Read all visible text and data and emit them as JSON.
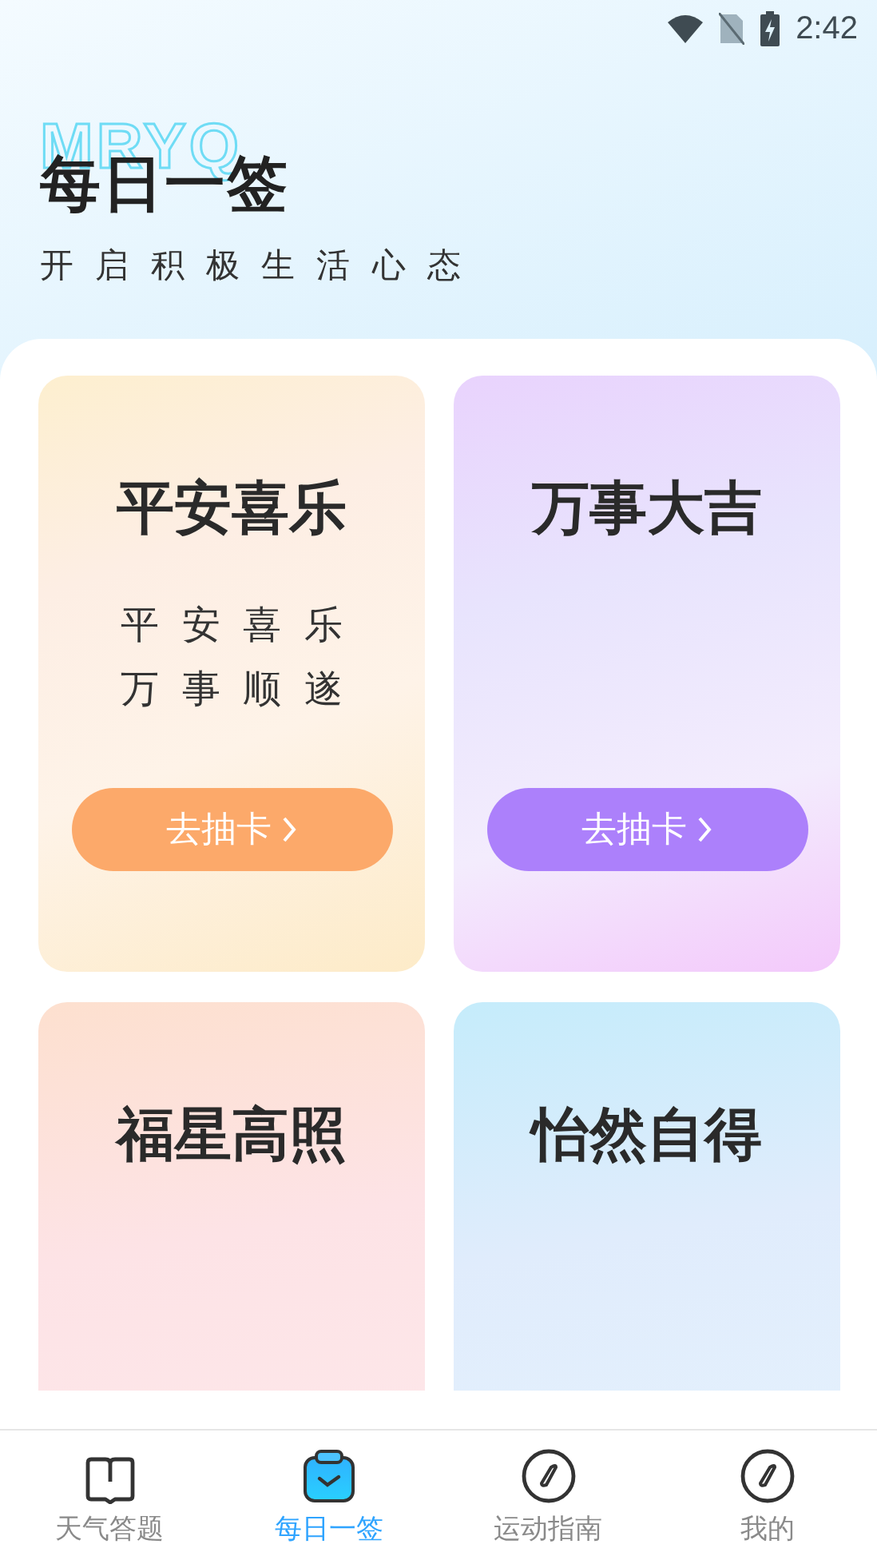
{
  "status_bar": {
    "time": "2:42"
  },
  "header": {
    "watermark": "MRYQ",
    "title": "每日一签",
    "subtitle": "开启积极生活心态"
  },
  "cards": [
    {
      "kind": "orange",
      "title": "平安喜乐",
      "lines": [
        "平安喜乐",
        "万事顺遂"
      ],
      "button": "去抽卡"
    },
    {
      "kind": "purple",
      "title": "万事大吉",
      "button": "去抽卡"
    },
    {
      "kind": "pink",
      "title": "福星高照"
    },
    {
      "kind": "blue",
      "title": "怡然自得"
    }
  ],
  "tabs": [
    {
      "label": "天气答题",
      "kind": "book",
      "selected": false
    },
    {
      "label": "每日一签",
      "kind": "bag",
      "selected": true
    },
    {
      "label": "运动指南",
      "kind": "compass",
      "selected": false
    },
    {
      "label": "我的",
      "kind": "compass",
      "selected": false
    }
  ]
}
